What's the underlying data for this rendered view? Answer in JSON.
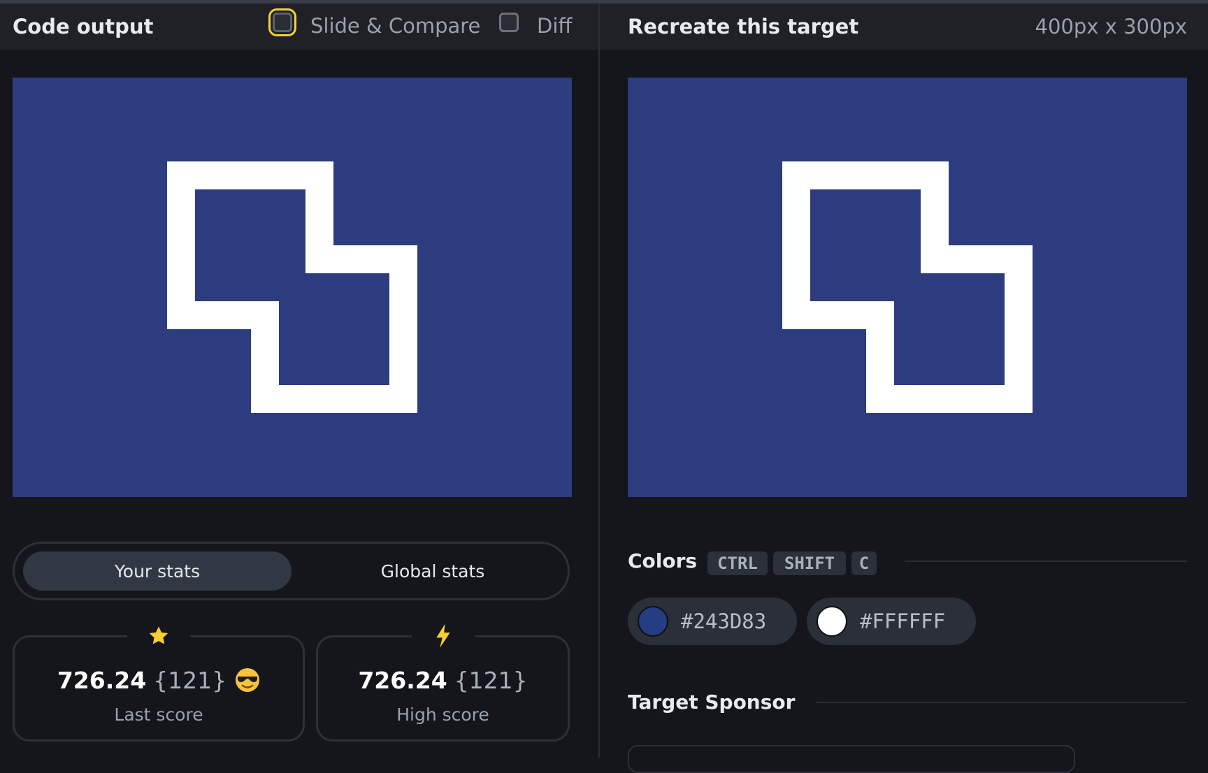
{
  "left_header": {
    "title": "Code output",
    "slide_compare_label": "Slide & Compare",
    "diff_label": "Diff"
  },
  "right_header": {
    "title": "Recreate this target",
    "dimensions": "400px x 300px"
  },
  "canvas": {
    "background": "#2D3C7F",
    "shape_color": "#FFFFFF"
  },
  "stats_toggle": {
    "your_stats": "Your stats",
    "global_stats": "Global stats"
  },
  "stats": {
    "last": {
      "score": "726.24",
      "chars": "{121}",
      "label": "Last score",
      "icon": "star-icon"
    },
    "high": {
      "score": "726.24",
      "chars": "{121}",
      "label": "High score",
      "icon": "lightning-icon"
    }
  },
  "colors_section": {
    "title": "Colors",
    "shortcut": [
      "CTRL",
      "SHIFT",
      "C"
    ],
    "swatches": [
      {
        "hex": "#243D83",
        "color": "#243D83"
      },
      {
        "hex": "#FFFFFF",
        "color": "#FFFFFF"
      }
    ]
  },
  "sponsor_section": {
    "title": "Target Sponsor"
  }
}
